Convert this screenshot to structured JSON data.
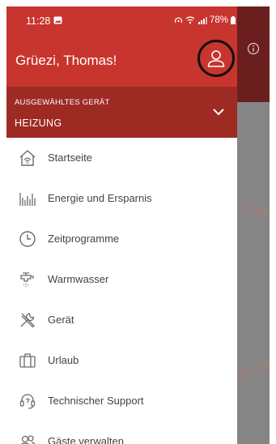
{
  "status_bar": {
    "time": "11:28",
    "battery": "78%"
  },
  "header": {
    "greeting": "Grüezi, Thomas!"
  },
  "device_selector": {
    "label": "AUSGEWÄHLTES GERÄT",
    "value": "HEIZUNG"
  },
  "menu": {
    "items": [
      {
        "label": "Startseite",
        "icon": "home-icon"
      },
      {
        "label": "Energie und Ersparnis",
        "icon": "bar-chart-icon"
      },
      {
        "label": "Zeitprogramme",
        "icon": "clock-icon"
      },
      {
        "label": "Warmwasser",
        "icon": "faucet-icon"
      },
      {
        "label": "Gerät",
        "icon": "tools-icon"
      },
      {
        "label": "Urlaub",
        "icon": "suitcase-icon"
      },
      {
        "label": "Technischer Support",
        "icon": "headset-icon"
      },
      {
        "label": "Gäste verwalten",
        "icon": "guests-icon"
      }
    ]
  },
  "colors": {
    "header": "#c8342e",
    "device_bar": "#9e2a24",
    "icon": "#6b6b6b"
  }
}
